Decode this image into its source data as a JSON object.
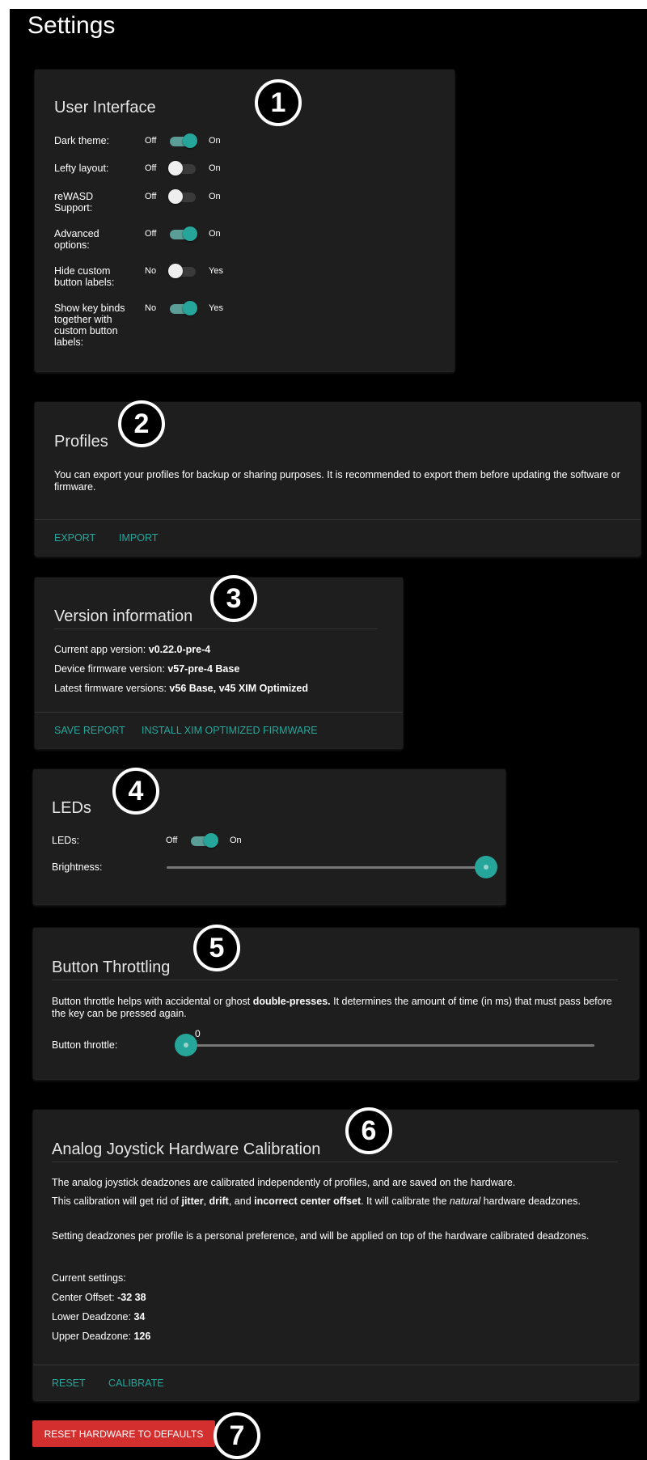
{
  "page": {
    "title": "Settings"
  },
  "badges": [
    "1",
    "2",
    "3",
    "4",
    "5",
    "6",
    "7"
  ],
  "ui": {
    "title": "User Interface",
    "rows": [
      {
        "label": "Dark theme:",
        "off": "Off",
        "on": "On",
        "state": "on"
      },
      {
        "label": "Lefty layout:",
        "off": "Off",
        "on": "On",
        "state": "off"
      },
      {
        "label": "reWASD Support:",
        "off": "Off",
        "on": "On",
        "state": "off"
      },
      {
        "label": "Advanced options:",
        "off": "Off",
        "on": "On",
        "state": "on"
      },
      {
        "label": "Hide custom button labels:",
        "off": "No",
        "on": "Yes",
        "state": "off"
      },
      {
        "label": "Show key binds together with custom button labels:",
        "off": "No",
        "on": "Yes",
        "state": "on"
      }
    ]
  },
  "profiles": {
    "title": "Profiles",
    "description": "You can export your profiles for backup or sharing purposes. It is recommended to export them before updating the software or firmware.",
    "export_label": "Export",
    "import_label": "Import"
  },
  "version": {
    "title": "Version information",
    "app_label": "Current app version:",
    "app_value": "v0.22.0-pre-4",
    "device_label": "Device firmware version:",
    "device_value": "v57-pre-4 Base",
    "latest_label": "Latest firmware versions:",
    "latest_value": "v56 Base, v45 XIM Optimized",
    "save_report_label": "Save report",
    "install_label": "Install XIM optimized firmware"
  },
  "leds": {
    "title": "LEDs",
    "leds_label": "LEDs:",
    "off": "Off",
    "on": "On",
    "state": "on",
    "brightness_label": "Brightness:",
    "brightness_fraction": 1.0
  },
  "throttle": {
    "title": "Button Throttling",
    "desc_pre": "Button throttle helps with accidental or ghost ",
    "desc_bold": "double-presses.",
    "desc_post": " It determines the amount of time (in ms) that must pass before the key can be pressed again.",
    "label": "Button throttle:",
    "value": "0",
    "fraction": 0.0
  },
  "calibration": {
    "title": "Analog Joystick Hardware Calibration",
    "p1": "The analog joystick deadzones are calibrated independently of profiles, and are saved on the hardware.",
    "p2_a": "This calibration will get rid of ",
    "p2_jitter": "jitter",
    "p2_b": ", ",
    "p2_drift": "drift",
    "p2_c": ", and ",
    "p2_offset": "incorrect center offset",
    "p2_d": ". It will calibrate the ",
    "p2_natural": "natural",
    "p2_e": " hardware deadzones.",
    "p3": "Setting deadzones per profile is a personal preference, and will be applied on top of the hardware calibrated deadzones.",
    "current_label": "Current settings:",
    "center_label": "Center Offset:",
    "center_value": "-32 38",
    "lower_label": "Lower Deadzone:",
    "lower_value": "34",
    "upper_label": "Upper Deadzone:",
    "upper_value": "126",
    "reset_label": "Reset",
    "calibrate_label": "Calibrate"
  },
  "reset_hardware_label": "Reset hardware to defaults",
  "colors": {
    "accent": "#26a69a",
    "danger": "#d32f2f",
    "card": "#1e1e1e",
    "background": "#000000"
  }
}
